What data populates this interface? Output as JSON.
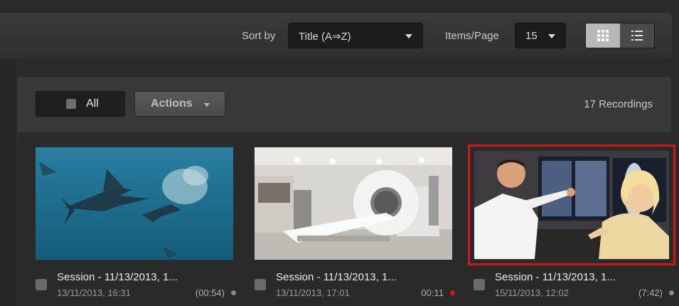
{
  "toolbar": {
    "sort_label": "Sort by",
    "sort_value": "Title (A⇒Z)",
    "items_label": "Items/Page",
    "items_value": "15",
    "view_grid_icon": "grid-view-icon",
    "view_list_icon": "list-view-icon"
  },
  "actionbar": {
    "all_label": "All",
    "actions_label": "Actions",
    "count_text": "17 Recordings"
  },
  "recordings": [
    {
      "title": "Session - 11/13/2013, 1...",
      "date": "13/11/2013, 16:31",
      "duration": "(00:54)",
      "status_color": "#888888",
      "thumbnail": "underwater-sailfish"
    },
    {
      "title": "Session - 11/13/2013, 1...",
      "date": "13/11/2013, 17:01",
      "duration": "00:11",
      "status_color": "#e31010",
      "thumbnail": "ct-scanner-room"
    },
    {
      "title": "Session - 11/13/2013, 1...",
      "date": "15/11/2013, 12:02",
      "duration": "(7:42)",
      "status_color": "#888888",
      "thumbnail": "doctor-patient-xray"
    }
  ],
  "colors": {
    "selection_border": "#d01a1a",
    "background": "#2a2a2a"
  }
}
